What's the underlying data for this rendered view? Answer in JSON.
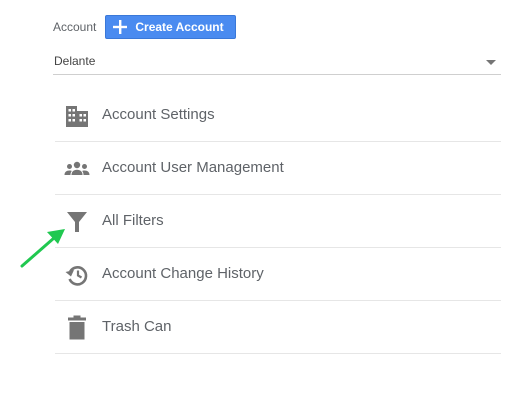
{
  "account": {
    "label": "Account",
    "create_button_label": "Create Account",
    "selected_account": "Delante"
  },
  "menu": {
    "items": [
      {
        "label": "Account Settings",
        "icon": "building-icon"
      },
      {
        "label": "Account User Management",
        "icon": "people-icon"
      },
      {
        "label": "All Filters",
        "icon": "filter-icon"
      },
      {
        "label": "Account Change History",
        "icon": "history-icon"
      },
      {
        "label": "Trash Can",
        "icon": "trash-icon"
      }
    ]
  },
  "colors": {
    "accent_button": "#4a8bf0",
    "icon_gray": "#757575",
    "text_gray": "#5f6368",
    "annotation_arrow": "#20c850"
  }
}
